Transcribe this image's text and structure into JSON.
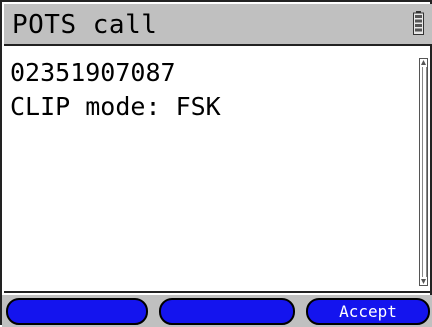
{
  "title_bar": {
    "title": "POTS call",
    "battery_icon": "battery-icon"
  },
  "content": {
    "lines": [
      "02351907087",
      "CLIP mode: FSK"
    ]
  },
  "softkeys": [
    {
      "label": ""
    },
    {
      "label": ""
    },
    {
      "label": "Accept"
    }
  ],
  "colors": {
    "title_background": "#c0c0c0",
    "softkey_background": "#1414ee",
    "softkey_text": "#ffffff"
  }
}
